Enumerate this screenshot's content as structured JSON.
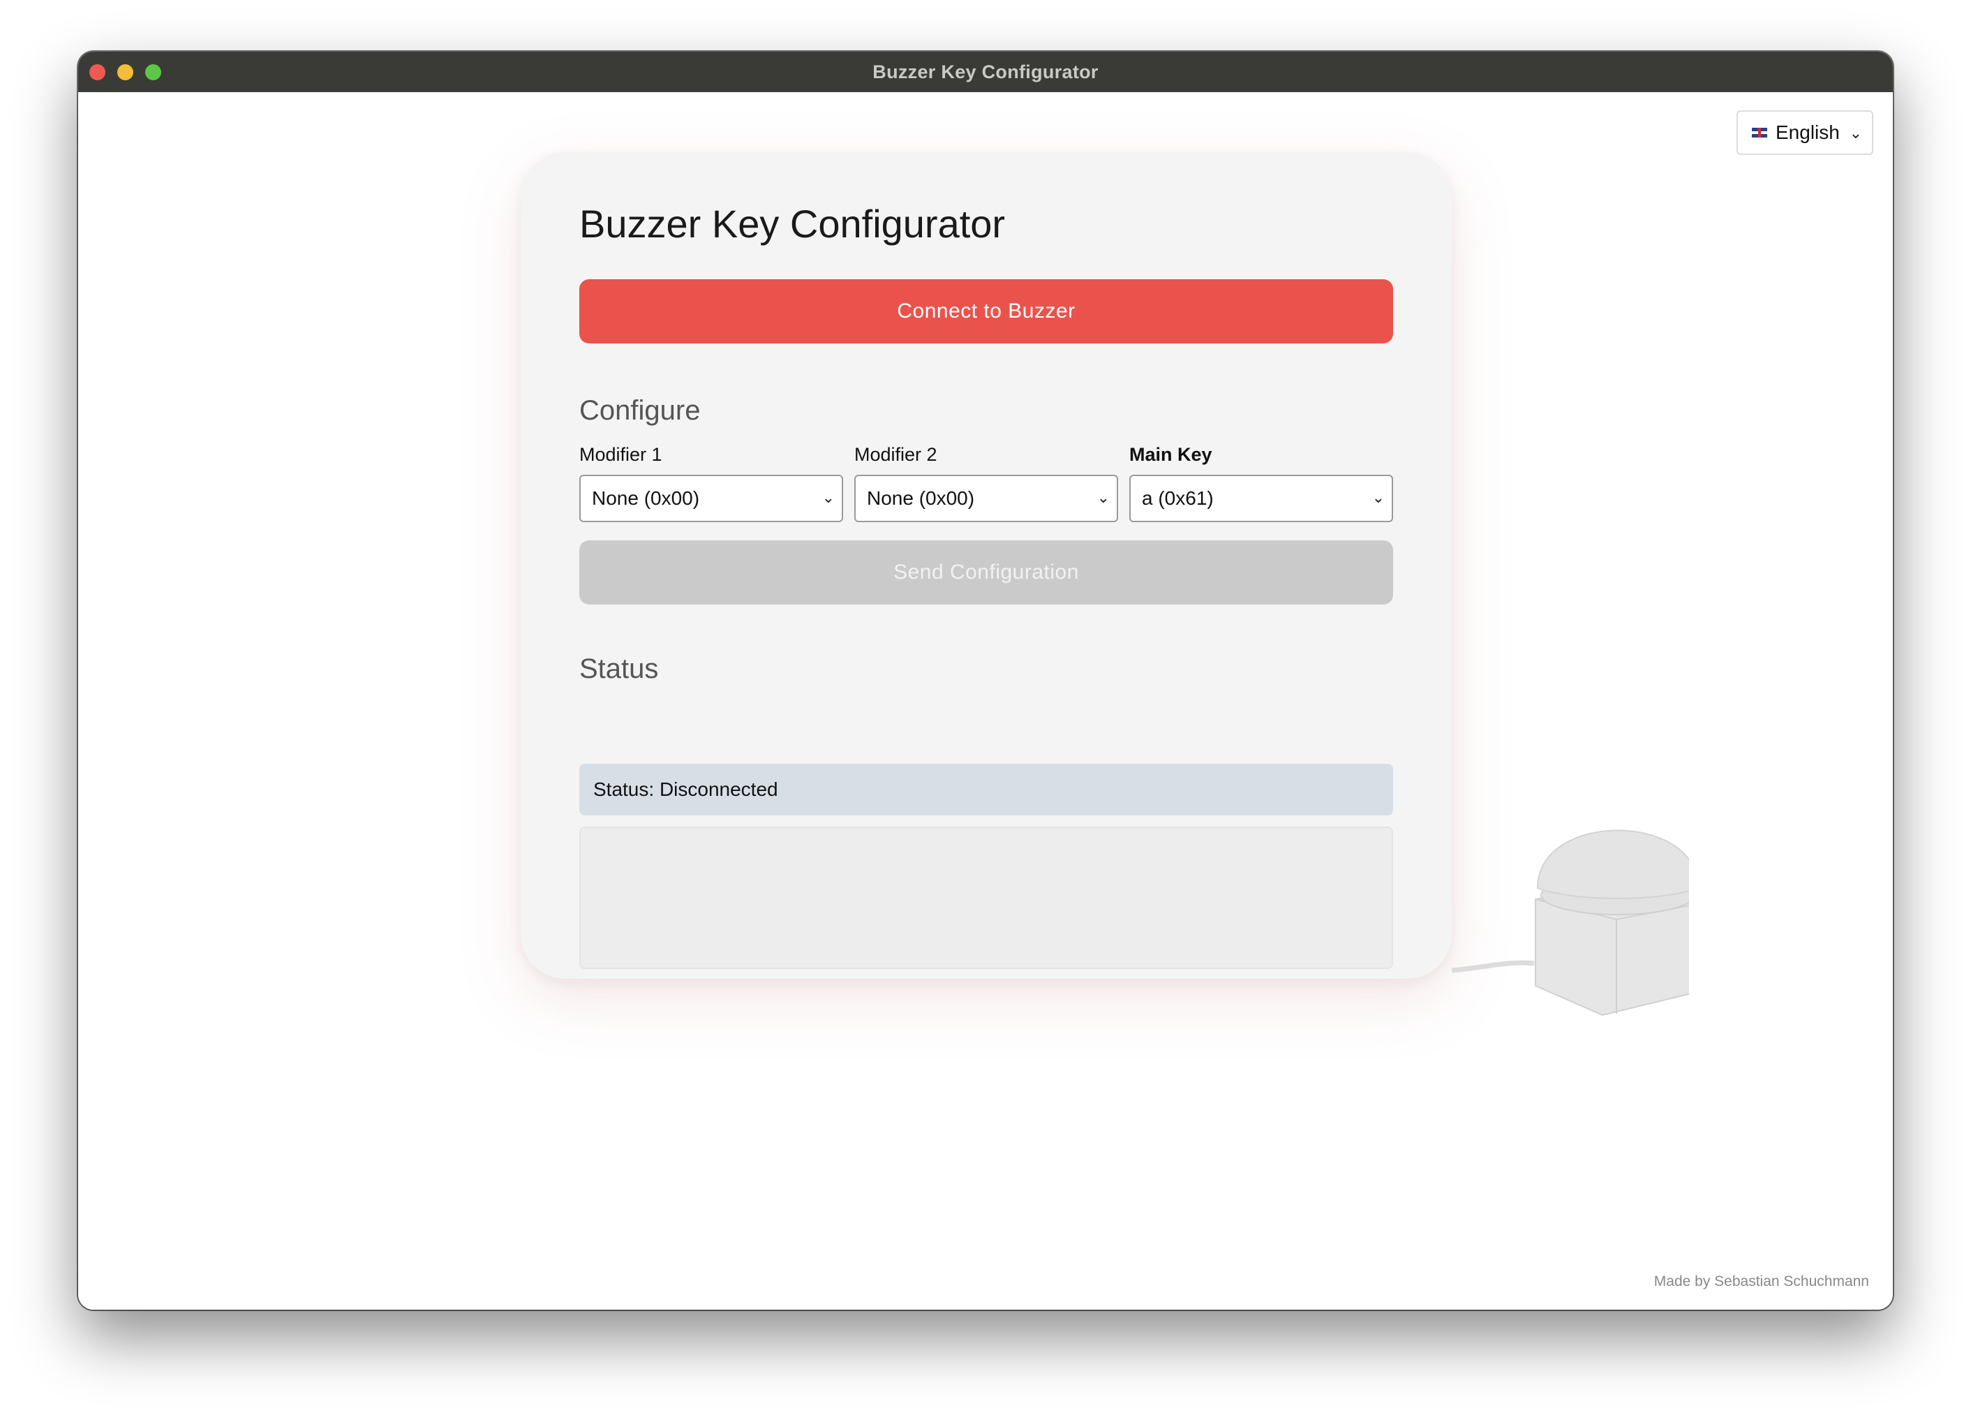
{
  "window": {
    "title": "Buzzer Key Configurator"
  },
  "language": {
    "selected": "English",
    "flag": "uk-flag"
  },
  "card": {
    "title": "Buzzer Key Configurator",
    "connect_label": "Connect to Buzzer",
    "configure_heading": "Configure",
    "fields": [
      {
        "label": "Modifier 1",
        "value": "None (0x00)"
      },
      {
        "label": "Modifier 2",
        "value": "None (0x00)"
      },
      {
        "label": "Main Key",
        "value": "a (0x61)"
      }
    ],
    "send_label": "Send Configuration",
    "status_heading": "Status",
    "status_text": "Status: Disconnected",
    "log_text": ""
  },
  "footer": {
    "credit": "Made by Sebastian Schuchmann"
  },
  "colors": {
    "accent": "#ea534c",
    "disabled": "#cacaca",
    "status_bg": "#d8dee6",
    "titlebar": "#3a3b37"
  }
}
